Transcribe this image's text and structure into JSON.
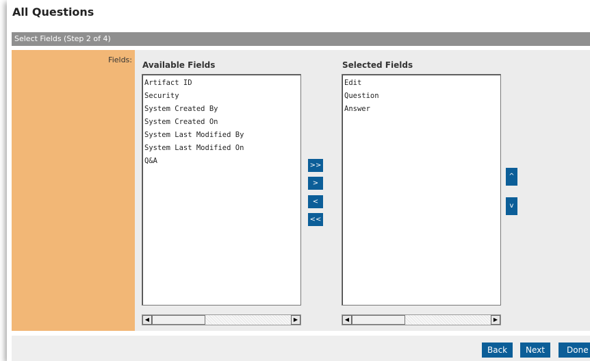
{
  "page": {
    "title": "All Questions",
    "step_label": "Select Fields (Step 2 of 4)"
  },
  "fields": {
    "label": "Fields:",
    "available_title": "Available Fields",
    "selected_title": "Selected Fields",
    "available": [
      "Artifact ID",
      "Security",
      "System Created By",
      "System Created On",
      "System Last Modified By",
      "System Last Modified On",
      "Q&A"
    ],
    "selected": [
      "Edit",
      "Question",
      "Answer"
    ]
  },
  "transfer": {
    "add_all": ">>",
    "add": ">",
    "remove": "<",
    "remove_all": "<<"
  },
  "order": {
    "up": "^",
    "down": "v"
  },
  "scroll": {
    "left": "◀",
    "right": "▶"
  },
  "footer": {
    "back": "Back",
    "next": "Next",
    "done": "Done"
  },
  "colors": {
    "accent": "#0c5e98",
    "label_column": "#f2b776",
    "step_bar": "#8f8f8f"
  }
}
